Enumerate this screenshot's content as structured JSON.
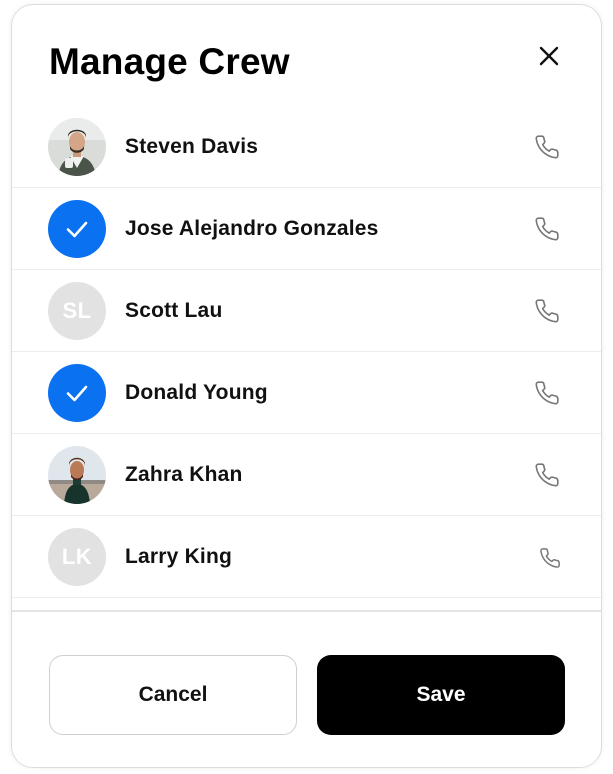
{
  "dialog": {
    "title": "Manage Crew",
    "close_icon": "close-icon"
  },
  "crew": [
    {
      "name": "Steven Davis",
      "avatar": "photo",
      "selected": false,
      "phone_icon": "phone-icon"
    },
    {
      "name": "Jose Alejandro Gonzales",
      "avatar": "check",
      "selected": true,
      "phone_icon": "phone-icon"
    },
    {
      "name": "Scott Lau",
      "avatar": "initials",
      "initials": "SL",
      "selected": false,
      "phone_icon": "phone-icon"
    },
    {
      "name": "Donald Young",
      "avatar": "check",
      "selected": true,
      "phone_icon": "phone-icon"
    },
    {
      "name": "Zahra Khan",
      "avatar": "photo",
      "selected": false,
      "phone_icon": "phone-icon"
    },
    {
      "name": "Larry King",
      "avatar": "initials",
      "initials": "LK",
      "selected": false,
      "phone_icon": "phone-icon"
    }
  ],
  "footer": {
    "cancel_label": "Cancel",
    "save_label": "Save"
  },
  "colors": {
    "accent": "#0a72f0",
    "initials_bg": "#e2e2e2",
    "primary_button": "#000000"
  }
}
